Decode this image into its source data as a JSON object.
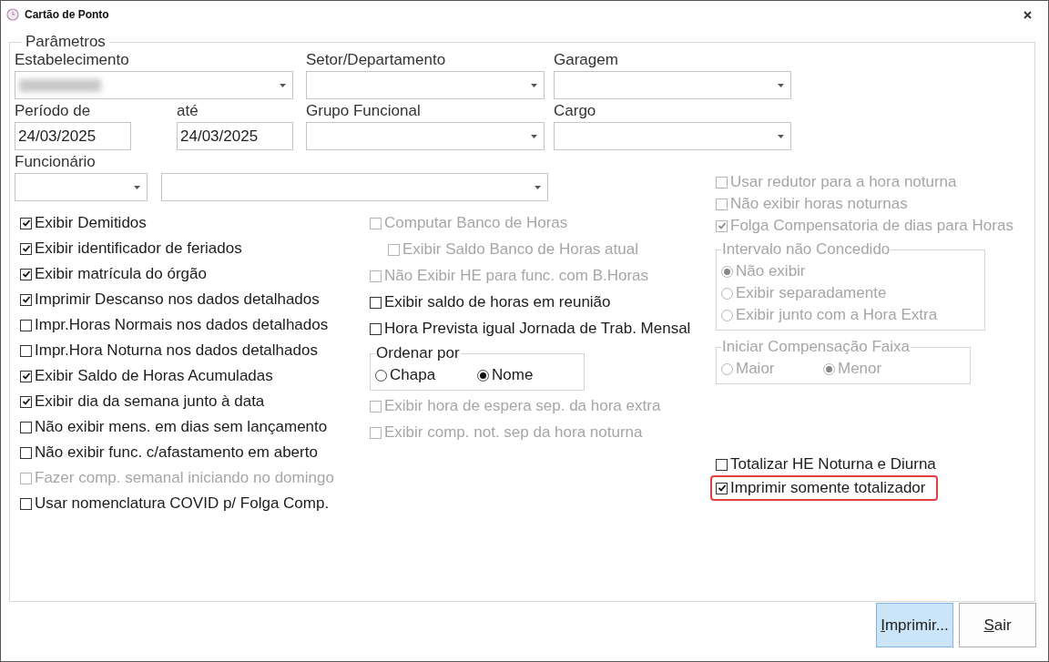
{
  "window": {
    "title": "Cartão de Ponto"
  },
  "parameters": {
    "title": "Parâmetros",
    "field_rows": [
      [
        {
          "label": "Estabelecimento",
          "kind": "combo",
          "redacted": true
        },
        {
          "label": "Setor/Departamento",
          "kind": "combo"
        },
        {
          "label": "Garagem",
          "kind": "combo"
        }
      ],
      [
        {
          "label": "Período de",
          "kind": "text",
          "value": "24/03/2025"
        },
        {
          "label": "até",
          "kind": "text",
          "value": "24/03/2025"
        },
        {
          "label": "Grupo Funcional",
          "kind": "combo"
        },
        {
          "label": "Cargo",
          "kind": "combo"
        }
      ],
      [
        {
          "label": "Funcionário",
          "kind": "combo"
        },
        {
          "kind": "combo"
        }
      ]
    ],
    "left_options": [
      {
        "kind": "checkbox",
        "label": "Exibir Demitidos",
        "checked": true,
        "disabled": false
      },
      {
        "kind": "checkbox",
        "label": "Exibir identificador de feriados",
        "checked": true,
        "disabled": false
      },
      {
        "kind": "checkbox",
        "label": "Exibir matrícula do órgão",
        "checked": true,
        "disabled": false
      },
      {
        "kind": "checkbox",
        "label": "Imprimir Descanso nos dados detalhados",
        "checked": true,
        "disabled": false
      },
      {
        "kind": "checkbox",
        "label": "Impr.Horas Normais nos dados detalhados",
        "checked": false,
        "disabled": false
      },
      {
        "kind": "checkbox",
        "label": "Impr.Hora Noturna nos dados detalhados",
        "checked": false,
        "disabled": false
      },
      {
        "kind": "checkbox",
        "label": "Exibir Saldo de Horas Acumuladas",
        "checked": true,
        "disabled": false
      },
      {
        "kind": "checkbox",
        "label": "Exibir dia da semana junto à data",
        "checked": true,
        "disabled": false
      },
      {
        "kind": "checkbox",
        "label": "Não exibir mens. em dias sem lançamento",
        "checked": false,
        "disabled": false
      },
      {
        "kind": "checkbox",
        "label": "Não exibir func. c/afastamento em aberto",
        "checked": false,
        "disabled": false
      },
      {
        "kind": "checkbox",
        "label": "Fazer comp. semanal iniciando no domingo",
        "checked": false,
        "disabled": true
      },
      {
        "kind": "checkbox",
        "label": "Usar nomenclatura COVID p/ Folga Comp.",
        "checked": false,
        "disabled": false
      }
    ],
    "middle_options": [
      {
        "kind": "checkbox",
        "label": "Computar Banco de Horas",
        "checked": false,
        "disabled": true,
        "children": [
          {
            "kind": "checkbox",
            "label": "Exibir Saldo Banco de Horas atual",
            "checked": false,
            "disabled": true
          }
        ]
      },
      {
        "kind": "checkbox",
        "label": "Não Exibir HE para func. com B.Horas",
        "checked": false,
        "disabled": true
      },
      {
        "kind": "checkbox",
        "label": "Exibir saldo de horas em reunião",
        "checked": false,
        "disabled": false
      },
      {
        "kind": "checkbox",
        "label": "Hora Prevista igual Jornada de Trab. Mensal",
        "checked": false,
        "disabled": false
      },
      {
        "kind": "radio_row",
        "title": "Ordenar por",
        "disabled": false,
        "options": [
          {
            "label": "Chapa",
            "selected": false
          },
          {
            "label": "Nome",
            "selected": true
          }
        ]
      },
      {
        "kind": "checkbox",
        "label": "Exibir hora de espera sep. da hora extra",
        "checked": false,
        "disabled": true
      },
      {
        "kind": "checkbox",
        "label": "Exibir comp. not. sep da hora noturna",
        "checked": false,
        "disabled": true
      }
    ],
    "right_options": [
      {
        "kind": "checkbox",
        "label": "Usar redutor para a hora noturna",
        "checked": false,
        "disabled": true
      },
      {
        "kind": "checkbox",
        "label": "Não exibir horas noturnas",
        "checked": false,
        "disabled": true
      },
      {
        "kind": "checkbox",
        "label": "Folga Compensatoria de dias para Horas",
        "checked": true,
        "disabled": true
      },
      {
        "kind": "radio_column",
        "title": "Intervalo não Concedido",
        "disabled": true,
        "options": [
          {
            "label": "Não exibir",
            "selected": true
          },
          {
            "label": "Exibir separadamente",
            "selected": false
          },
          {
            "label": "Exibir junto com a Hora Extra",
            "selected": false
          }
        ]
      },
      {
        "kind": "radio_row",
        "title": "Iniciar Compensação Faixa",
        "disabled": true,
        "options": [
          {
            "label": "Maior",
            "selected": false
          },
          {
            "label": "Menor",
            "selected": true
          }
        ]
      },
      {
        "kind": "checkbox",
        "label": "Totalizar HE Noturna e Diurna",
        "checked": false,
        "disabled": false,
        "highlighted": false
      },
      {
        "kind": "checkbox",
        "label": "Imprimir somente totalizador",
        "checked": true,
        "disabled": false,
        "highlighted": true
      }
    ]
  },
  "buttons": [
    {
      "label": "Imprimir...",
      "focused": true
    },
    {
      "label": "Sair",
      "focused": false
    }
  ]
}
